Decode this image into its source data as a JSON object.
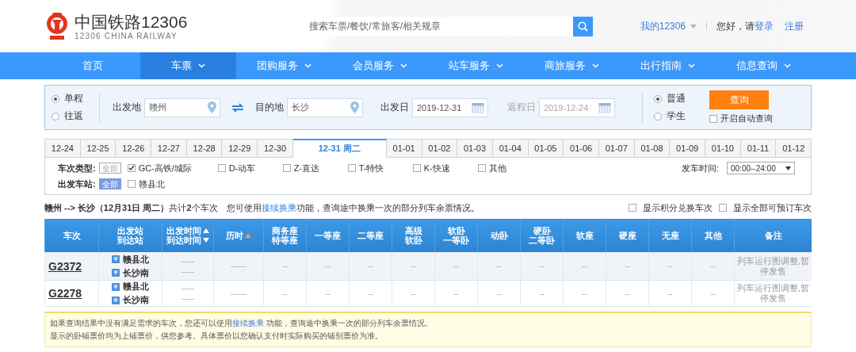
{
  "header": {
    "logo_title": "中国铁路12306",
    "logo_subtitle": "12306 CHINA RAILWAY",
    "search_placeholder": "搜索车票/餐饮/常旅客/相关规章",
    "my_account": "我的12306",
    "greeting": "您好，请",
    "login": "登录",
    "register": "注册"
  },
  "nav": [
    {
      "label": "首页",
      "dropdown": false,
      "selected": false
    },
    {
      "label": "车票",
      "dropdown": true,
      "selected": true
    },
    {
      "label": "团购服务",
      "dropdown": true,
      "selected": false
    },
    {
      "label": "会员服务",
      "dropdown": true,
      "selected": false
    },
    {
      "label": "站车服务",
      "dropdown": true,
      "selected": false
    },
    {
      "label": "商旅服务",
      "dropdown": true,
      "selected": false
    },
    {
      "label": "出行指南",
      "dropdown": true,
      "selected": false
    },
    {
      "label": "信息查询",
      "dropdown": true,
      "selected": false
    }
  ],
  "query": {
    "trip_types": [
      {
        "label": "单程",
        "selected": true
      },
      {
        "label": "往返",
        "selected": false
      }
    ],
    "from": {
      "label": "出发地",
      "value": "赣州"
    },
    "to": {
      "label": "目的地",
      "value": "长沙"
    },
    "depart_date": {
      "label": "出发日",
      "value": "2019-12-31",
      "disabled": false
    },
    "return_date": {
      "label": "返程日",
      "value": "2019-12-24",
      "disabled": true
    },
    "passenger_types": [
      {
        "label": "普通",
        "selected": true
      },
      {
        "label": "学生",
        "selected": false
      }
    ],
    "search_button": "查询",
    "auto_query": {
      "label": "开启自动查询",
      "checked": false
    }
  },
  "date_tabs": [
    {
      "label": "12-24",
      "selected": false
    },
    {
      "label": "12-25",
      "selected": false
    },
    {
      "label": "12-26",
      "selected": false
    },
    {
      "label": "12-27",
      "selected": false
    },
    {
      "label": "12-28",
      "selected": false
    },
    {
      "label": "12-29",
      "selected": false
    },
    {
      "label": "12-30",
      "selected": false
    },
    {
      "label": "12-31 周二",
      "selected": true
    },
    {
      "label": "01-01",
      "selected": false
    },
    {
      "label": "01-02",
      "selected": false
    },
    {
      "label": "01-03",
      "selected": false
    },
    {
      "label": "01-04",
      "selected": false
    },
    {
      "label": "01-05",
      "selected": false
    },
    {
      "label": "01-06",
      "selected": false
    },
    {
      "label": "01-07",
      "selected": false
    },
    {
      "label": "01-08",
      "selected": false
    },
    {
      "label": "01-09",
      "selected": false
    },
    {
      "label": "01-10",
      "selected": false
    },
    {
      "label": "01-11",
      "selected": false
    },
    {
      "label": "01-12",
      "selected": false
    }
  ],
  "filters": {
    "train_type": {
      "label": "车次类型:",
      "all": {
        "label": "全部",
        "selected": false
      },
      "options": [
        {
          "label": "GC-高铁/城际",
          "checked": true
        },
        {
          "label": "D-动车",
          "checked": false
        },
        {
          "label": "Z-直达",
          "checked": false
        },
        {
          "label": "T-特快",
          "checked": false
        },
        {
          "label": "K-快速",
          "checked": false
        },
        {
          "label": "其他",
          "checked": false
        }
      ]
    },
    "depart_time": {
      "label": "发车时间:",
      "value": "00:00--24:00"
    },
    "depart_station": {
      "label": "出发车站:",
      "all": {
        "label": "全部",
        "selected": true
      },
      "options": [
        {
          "label": "赣县北",
          "checked": false
        }
      ]
    }
  },
  "summary": {
    "route": "**赣州 --> 长沙（12月31日  周二）**共计**2**个车次",
    "tip_before": "您可使用",
    "tip_link": "接续换乘",
    "tip_after": "功能，查询途中换乘一次的部分列车余票情况。",
    "options": [
      {
        "label": "显示积分兑换车次",
        "checked": false
      },
      {
        "label": "显示全部可预订车次",
        "checked": false
      }
    ]
  },
  "table": {
    "columns": [
      {
        "lines": [
          "车次"
        ],
        "kind": "plain"
      },
      {
        "lines": [
          "出发站",
          "到达站"
        ],
        "kind": "plain"
      },
      {
        "lines": [
          "出发时间",
          "到达时间"
        ],
        "kind": "sortable"
      },
      {
        "lines": [
          "历时"
        ],
        "kind": "sorted"
      },
      {
        "lines": [
          "商务座",
          "特等座"
        ],
        "kind": "plain"
      },
      {
        "lines": [
          "一等座"
        ],
        "kind": "plain"
      },
      {
        "lines": [
          "二等座"
        ],
        "kind": "plain"
      },
      {
        "lines": [
          "高级",
          "软卧"
        ],
        "kind": "plain"
      },
      {
        "lines": [
          "软卧",
          "一等卧"
        ],
        "kind": "plain"
      },
      {
        "lines": [
          "动卧"
        ],
        "kind": "plain"
      },
      {
        "lines": [
          "硬卧",
          "二等卧"
        ],
        "kind": "plain"
      },
      {
        "lines": [
          "软座"
        ],
        "kind": "plain"
      },
      {
        "lines": [
          "硬座"
        ],
        "kind": "plain"
      },
      {
        "lines": [
          "无座"
        ],
        "kind": "plain"
      },
      {
        "lines": [
          "其他"
        ],
        "kind": "plain"
      },
      {
        "lines": [
          "备注"
        ],
        "kind": "plain"
      }
    ],
    "rows": [
      {
        "train": "G2372",
        "from": "赣县北",
        "to": "长沙南",
        "depart": "-----",
        "arrive": "-----",
        "duration": "------",
        "seats": [
          "--",
          "--",
          "--",
          "--",
          "--",
          "--",
          "--",
          "--",
          "--",
          "--",
          "--"
        ],
        "remark": "列车运行图调整,暂停发售"
      },
      {
        "train": "G2278",
        "from": "赣县北",
        "to": "长沙南",
        "depart": "-----",
        "arrive": "-----",
        "duration": "------",
        "seats": [
          "--",
          "--",
          "--",
          "--",
          "--",
          "--",
          "--",
          "--",
          "--",
          "--",
          "--"
        ],
        "remark": "列车运行图调整,暂停发售"
      }
    ]
  },
  "notice": {
    "line1_before": "如果查询结果中没有满足需求的车次，您还可以使用",
    "line1_link": "接续换乘",
    "line1_after": " 功能，查询途中换乘一次的部分列车余票情况。",
    "line2": "显示的卧铺票价均为上铺票价，供您参考。具体票价以您确认支付时实际购买的铺别票价为准。"
  }
}
